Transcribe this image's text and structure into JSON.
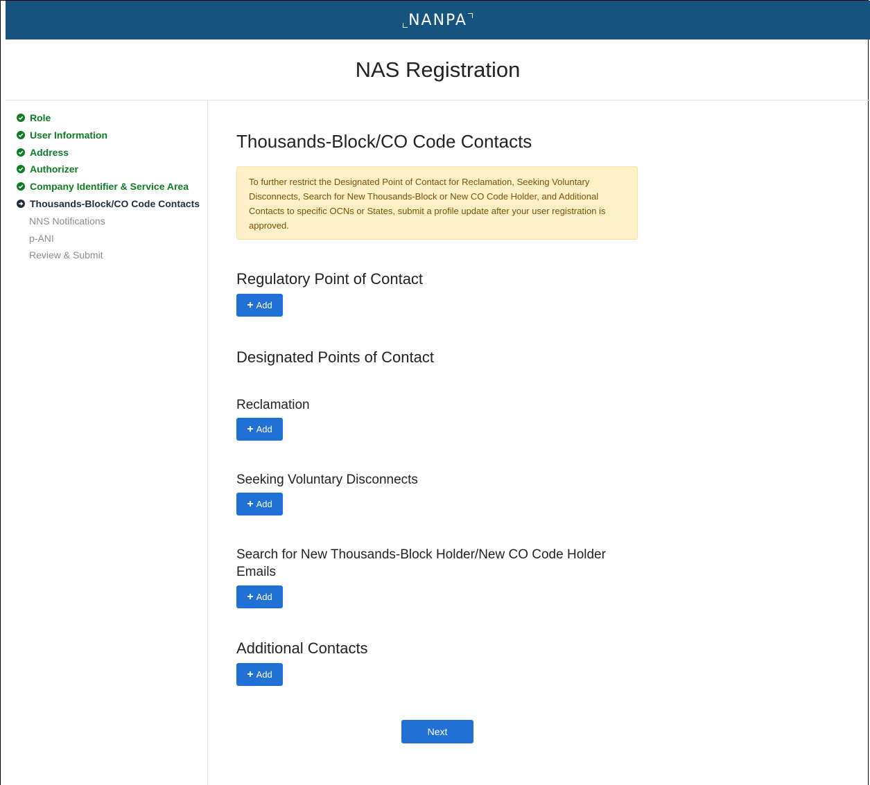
{
  "header": {
    "brand": "NANPA"
  },
  "page": {
    "title": "NAS Registration"
  },
  "sidebar": {
    "steps": [
      {
        "label": "Role",
        "state": "done"
      },
      {
        "label": "User Information",
        "state": "done"
      },
      {
        "label": "Address",
        "state": "done"
      },
      {
        "label": "Authorizer",
        "state": "done"
      },
      {
        "label": "Company Identifier & Service Area",
        "state": "done"
      },
      {
        "label": "Thousands-Block/CO Code Contacts",
        "state": "current"
      },
      {
        "label": "NNS Notifications",
        "state": "todo"
      },
      {
        "label": "p-ANI",
        "state": "todo"
      },
      {
        "label": "Review & Submit",
        "state": "todo"
      }
    ]
  },
  "main": {
    "title": "Thousands-Block/CO Code Contacts",
    "notice": "To further restrict the Designated Point of Contact for Reclamation, Seeking Voluntary Disconnects, Search for New Thousands-Block or New CO Code Holder, and Additional Contacts to specific OCNs or States, submit a profile update after your user registration is approved.",
    "regulatory_title": "Regulatory Point of Contact",
    "designated_title": "Designated Points of Contact",
    "reclamation_title": "Reclamation",
    "voluntary_title": "Seeking Voluntary Disconnects",
    "search_title": "Search for New Thousands-Block Holder/New CO Code Holder Emails",
    "additional_title": "Additional Contacts",
    "add_label": "Add",
    "next_label": "Next"
  },
  "colors": {
    "header": "#17537f",
    "done": "#0d7d22",
    "button": "#2070d6",
    "notice_bg": "#fdf0c6"
  }
}
